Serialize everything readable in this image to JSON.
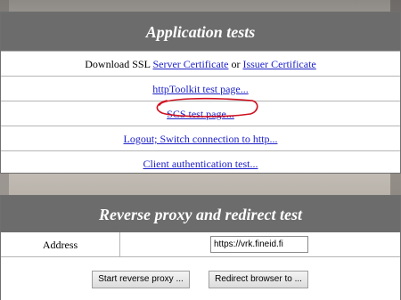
{
  "app_tests": {
    "title": "Application tests",
    "download_prefix": "Download SSL",
    "server_cert_link": "Server Certificate",
    "download_or": "or",
    "issuer_cert_link": "Issuer Certificate",
    "links": {
      "httptoolkit": "httpToolkit test page...",
      "scs": "SCS test page...",
      "logout": "Logout; Switch connection to http...",
      "client_auth": "Client authentication test..."
    },
    "annotation_color": "#d0101e"
  },
  "proxy": {
    "title": "Reverse proxy and redirect test",
    "address_label": "Address",
    "address_value": "https://vrk.fineid.fi",
    "start_button": "Start reverse proxy ...",
    "redirect_button": "Redirect browser to ..."
  }
}
